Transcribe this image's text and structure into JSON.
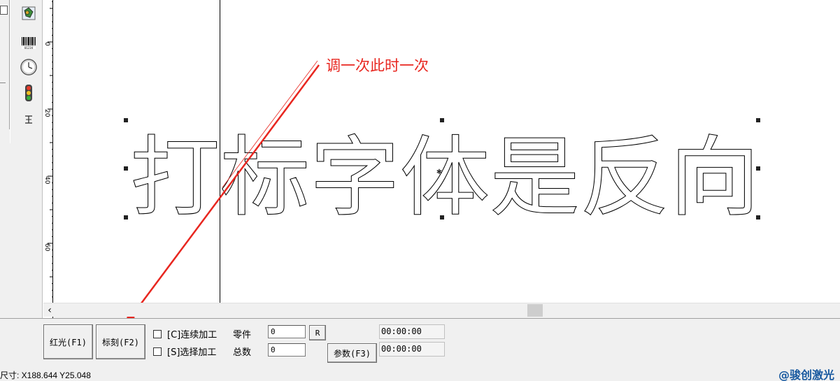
{
  "canvas": {
    "text_object": "打标字体是反向",
    "annotation": "调一次此时一次"
  },
  "ruler": {
    "ticks": [
      "0",
      "20",
      "40",
      "60"
    ]
  },
  "controls": {
    "red_light_label": "红光(F1)",
    "mark_label": "标刻(F2)",
    "continuous_label": "[C]连续加工",
    "select_label": "[S]选择加工",
    "parts_label": "零件",
    "total_label": "总数",
    "parts_value": "0",
    "total_value": "0",
    "reset_label": "R",
    "params_label": "参数(F3)",
    "time1": "00:00:00",
    "time2": "00:00:00"
  },
  "status": {
    "coords": "尺寸: X188.644 Y25.048",
    "watermark": "@骏创激光"
  },
  "toolbar": {
    "icons": [
      "vector-import-icon",
      "barcode-icon",
      "timer-icon",
      "io-light-icon",
      "extend-axis-icon"
    ]
  },
  "colors": {
    "annotation": "#e8261f",
    "watermark": "#1a5aa0"
  }
}
